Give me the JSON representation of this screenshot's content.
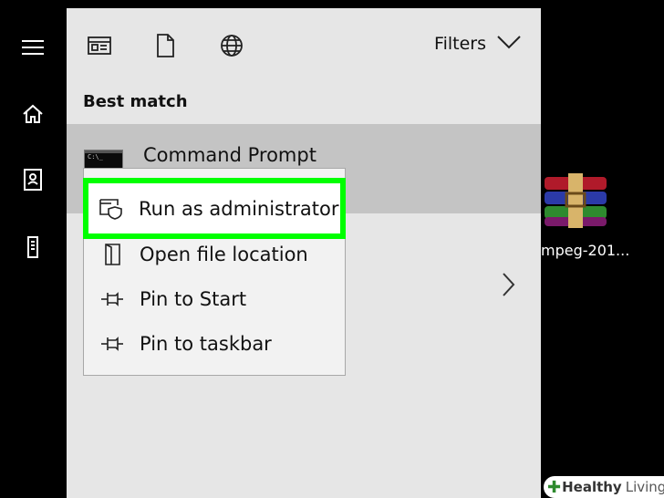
{
  "rail": {
    "icons": [
      "hamburger-menu-icon",
      "home-icon",
      "contact-book-icon",
      "tower-server-icon"
    ]
  },
  "header": {
    "filters_label": "Filters",
    "icons": [
      "document-view-icon",
      "file-icon",
      "globe-icon",
      "chevron-down-icon"
    ]
  },
  "best_match_label": "Best match",
  "result": {
    "title": "Command Prompt",
    "thumb_text": "C:\\_"
  },
  "context_menu": {
    "items": [
      {
        "label": "Run as administrator",
        "icon": "shield-window-icon",
        "highlighted": true
      },
      {
        "label": "Open file location",
        "icon": "folder-location-icon"
      },
      {
        "label": "Pin to Start",
        "icon": "pin-icon"
      },
      {
        "label": "Pin to taskbar",
        "icon": "pin-icon"
      }
    ]
  },
  "desktop": {
    "icon": "winrar-archive-icon",
    "label": "mpeg-201..."
  },
  "watermark": {
    "bold": "Healthy",
    "light": "Living"
  },
  "colors": {
    "panel_bg": "#e6e6e6",
    "selected_row": "#c4c4c4",
    "highlight_outline": "#00ff00",
    "desktop_bg": "#000000"
  }
}
